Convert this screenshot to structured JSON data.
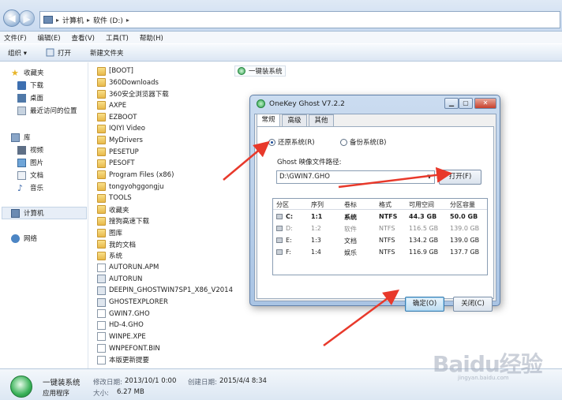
{
  "address": {
    "crumbs": [
      "计算机",
      "软件 (D:)"
    ]
  },
  "menu": [
    "文件(F)",
    "编辑(E)",
    "查看(V)",
    "工具(T)",
    "帮助(H)"
  ],
  "toolbar": {
    "organize": "组织 ▾",
    "open": "打开",
    "new_folder": "新建文件夹"
  },
  "sidebar": {
    "favorites": "收藏夹",
    "downloads": "下载",
    "desktop": "桌面",
    "recent": "最近访问的位置",
    "libraries": "库",
    "videos": "视频",
    "pictures": "图片",
    "documents": "文档",
    "music": "音乐",
    "computer": "计算机",
    "network": "网络"
  },
  "files": [
    {
      "name": "[BOOT]",
      "type": "folder"
    },
    {
      "name": "360Downloads",
      "type": "folder"
    },
    {
      "name": "360安全浏览器下载",
      "type": "folder"
    },
    {
      "name": "AXPE",
      "type": "folder"
    },
    {
      "name": "EZBOOT",
      "type": "folder"
    },
    {
      "name": "IQIYI Video",
      "type": "folder"
    },
    {
      "name": "MyDrivers",
      "type": "folder"
    },
    {
      "name": "PESETUP",
      "type": "folder"
    },
    {
      "name": "PESOFT",
      "type": "folder"
    },
    {
      "name": "Program Files (x86)",
      "type": "folder"
    },
    {
      "name": "tongyohggongju",
      "type": "folder"
    },
    {
      "name": "TOOLS",
      "type": "folder"
    },
    {
      "name": "收藏夹",
      "type": "folder"
    },
    {
      "name": "搜狗高速下载",
      "type": "folder"
    },
    {
      "name": "图库",
      "type": "folder"
    },
    {
      "name": "我的文档",
      "type": "folder"
    },
    {
      "name": "系统",
      "type": "folder"
    },
    {
      "name": "AUTORUN.APM",
      "type": "file"
    },
    {
      "name": "AUTORUN",
      "type": "app"
    },
    {
      "name": "DEEPIN_GHOSTWIN7SP1_X86_V2014",
      "type": "app"
    },
    {
      "name": "GHOSTEXPLORER",
      "type": "app"
    },
    {
      "name": "GWIN7.GHO",
      "type": "file"
    },
    {
      "name": "HD-4.GHO",
      "type": "file"
    },
    {
      "name": "WINPE.XPE",
      "type": "file"
    },
    {
      "name": "WNPEFONT.BIN",
      "type": "file"
    },
    {
      "name": "本版更新提要",
      "type": "file"
    }
  ],
  "onekey_shortcut": "一键装系统",
  "dialog": {
    "title": "OneKey Ghost V7.2.2",
    "tabs": [
      "常规",
      "高级",
      "其他"
    ],
    "radio_restore": "还原系统(R)",
    "radio_backup": "备份系统(B)",
    "path_label": "Ghost 映像文件路径:",
    "path_value": "D:\\GWIN7.GHO",
    "open_label": "打开(F)",
    "table": {
      "headers": [
        "分区",
        "序列",
        "卷标",
        "格式",
        "可用空间",
        "分区容量"
      ],
      "rows": [
        [
          "C:",
          "1:1",
          "系统",
          "NTFS",
          "44.3 GB",
          "50.0 GB"
        ],
        [
          "D:",
          "1:2",
          "软件",
          "NTFS",
          "116.5 GB",
          "139.0 GB"
        ],
        [
          "E:",
          "1:3",
          "文档",
          "NTFS",
          "134.2 GB",
          "139.0 GB"
        ],
        [
          "F:",
          "1:4",
          "娱乐",
          "NTFS",
          "116.9 GB",
          "137.7 GB"
        ]
      ]
    },
    "ok_label": "确定(O)",
    "cancel_label": "关闭(C)"
  },
  "details": {
    "name": "一键装系统",
    "type": "应用程序",
    "modified_label": "修改日期:",
    "modified": "2013/10/1 0:00",
    "created_label": "创建日期:",
    "created": "2015/4/4 8:34",
    "size_label": "大小:",
    "size": "6.27 MB"
  },
  "watermark": {
    "brand": "Baidu经验",
    "url": "jingyan.baidu.com"
  },
  "colors": {
    "arrow": "#e8392b",
    "accent": "#1f4f9a"
  }
}
